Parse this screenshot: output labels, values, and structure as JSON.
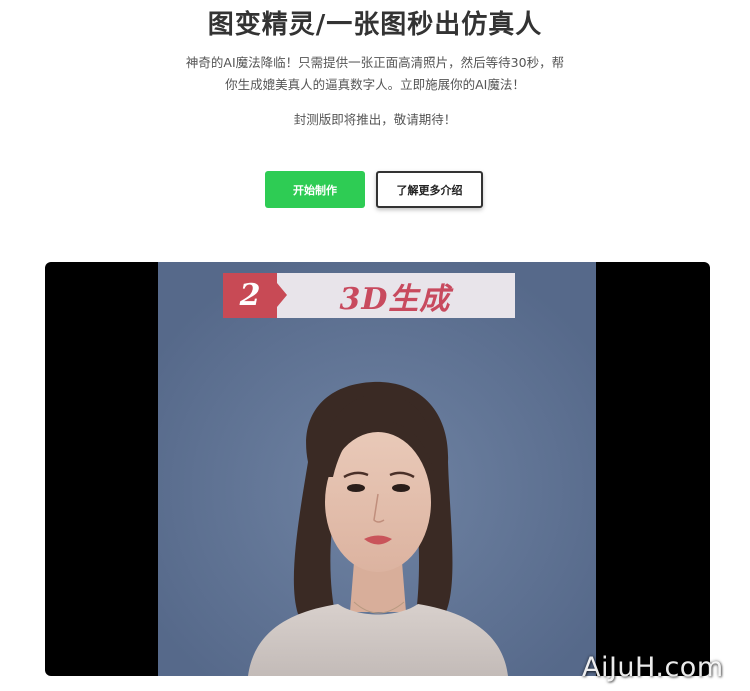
{
  "hero": {
    "title": "图变精灵/一张图秒出仿真人",
    "description": "神奇的AI魔法降临！只需提供一张正面高清照片，然后等待30秒，帮你生成媲美真人的逼真数字人。立即施展你的AI魔法！",
    "notice": "封测版即将推出，敬请期待！"
  },
  "buttons": {
    "start_label": "开始制作",
    "learn_more_label": "了解更多介绍"
  },
  "video": {
    "step_number": "2",
    "step_title": "3D生成"
  },
  "watermark": "AiJuH.com"
}
